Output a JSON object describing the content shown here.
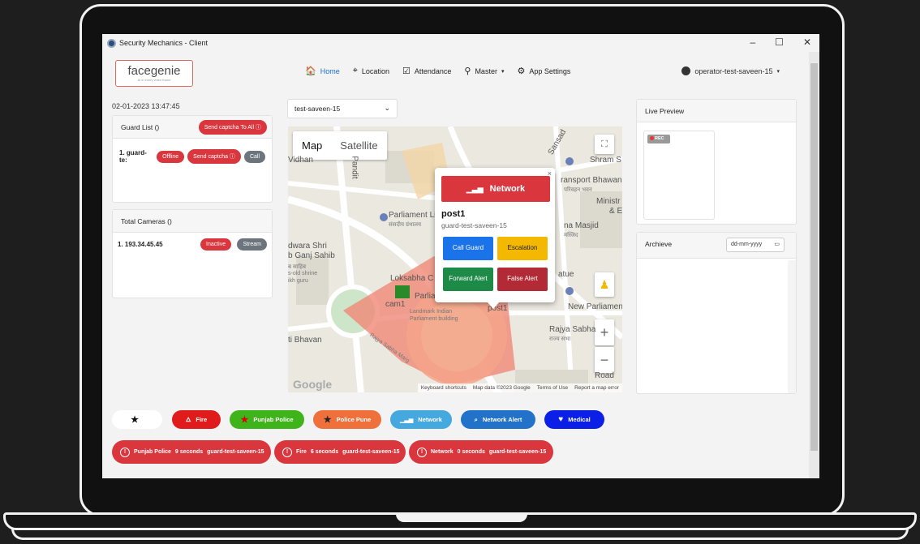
{
  "window": {
    "title": "Security Mechanics - Client",
    "min": "–",
    "max": "☐",
    "close": "✕"
  },
  "header": {
    "logo_text": "facegenie",
    "logo_tagline": "AI in every video frame",
    "nav": [
      {
        "label": "Home",
        "icon": "home-icon",
        "glyph": "🏠"
      },
      {
        "label": "Location",
        "icon": "location-pin-icon",
        "glyph": "⌖"
      },
      {
        "label": "Attendance",
        "icon": "calendar-check-icon",
        "glyph": "☑"
      },
      {
        "label": "Master",
        "icon": "user-icon",
        "glyph": "⚲",
        "caret": "▾"
      },
      {
        "label": "App Settings",
        "icon": "gear-icon",
        "glyph": "⚙"
      }
    ],
    "user": "operator-test-saveen-15",
    "user_caret": "▾"
  },
  "left": {
    "datetime": "02-01-2023 13:47:45",
    "guard_list": {
      "title": "Guard List ()",
      "send_all_label": "Send captcha To All",
      "rows": [
        {
          "name": "1. guard-te:",
          "status": "Offline",
          "captcha": "Send captcha",
          "call": "Call"
        }
      ]
    },
    "cameras": {
      "title": "Total Cameras ()",
      "rows": [
        {
          "name": "1. 193.34.45.45",
          "status": "Inactive",
          "stream": "Stream"
        }
      ]
    }
  },
  "map": {
    "location_select": "test-saveen-15",
    "tabs": [
      "Map",
      "Satellite"
    ],
    "labels": {
      "parliament_library": "Parliament Library",
      "parliament_library_hi": "संसदीय ग्रंथालय",
      "transport_bhawan": "ransport Bhawan",
      "transport_bhawan_hi": "परिवहन भवन",
      "ministry": "Ministr",
      "ministry2": "& E",
      "masjid": "na Masjid",
      "masjid_hi": "मस्जिद",
      "gurudwara1": "dwara Shri",
      "gurudwara2": "b Ganj Sahib",
      "gurudwara3": "ब साहिब",
      "gurudwara4": "s-old shrine",
      "gurudwara5": "ikh guru",
      "loksabha": "Loksabha C",
      "parliament_of": "Parliament of",
      "landmark1": "Landmark Indian",
      "landmark2": "Parliament building",
      "new_parliament": "New Parliamen",
      "rajya_sabha": "Rajya Sabha",
      "rajya_sabha_hi": "राज्य सभा",
      "rajya_marg": "Rajya Sabha Marg",
      "bhavan": "ti Bhavan",
      "sansad": "Sansad",
      "shram": "Shram S",
      "atue": "atue",
      "road": "Road",
      "vidhan": "Vidhan",
      "pandit": "Pandit",
      "cam": "cam1",
      "post": "post1"
    },
    "attribution": [
      "Keyboard shortcuts",
      "Map data ©2023 Google",
      "Terms of Use",
      "Report a map error"
    ],
    "google": "Google",
    "zoom_in": "+",
    "zoom_out": "−"
  },
  "popup": {
    "banner": "Network",
    "title": "post1",
    "subtitle": "guard-test-saveen-15",
    "close": "×",
    "buttons": {
      "call": "Call Guard",
      "escalation": "Escalation",
      "forward": "Forward Alert",
      "false": "False Alert"
    }
  },
  "right": {
    "live_preview_title": "Live Preview",
    "rec": "REC",
    "archive_title": "Archieve",
    "date_placeholder": "dd-mm-yyyy"
  },
  "legend": [
    {
      "label": "",
      "color": "#ffffff",
      "icon": "star-icon"
    },
    {
      "label": "Fire",
      "color": "#e01b1b",
      "icon": "fire-icon"
    },
    {
      "label": "Punjab Police",
      "color": "#3fb41a",
      "icon": "star-icon"
    },
    {
      "label": "Police Pune",
      "color": "#f0703c",
      "icon": "star-icon"
    },
    {
      "label": "Network",
      "color": "#45a8df",
      "icon": "signal-icon"
    },
    {
      "label": "Network Alert",
      "color": "#2372c9",
      "icon": "search-icon"
    },
    {
      "label": "Medical",
      "color": "#0b1fe6",
      "icon": "heart-icon"
    }
  ],
  "alerts": [
    {
      "type": "Punjab Police",
      "time": "9 seconds",
      "guard": "guard-test-saveen-15"
    },
    {
      "type": "Fire",
      "time": "6 seconds",
      "guard": "guard-test-saveen-15"
    },
    {
      "type": "Network",
      "time": "0 seconds",
      "guard": "guard-test-saveen-15"
    }
  ],
  "colors": {
    "primary_red": "#d9363e",
    "blue": "#1a6fd6",
    "yellow": "#f5b800",
    "green": "#1e8a48",
    "dark_red": "#b22a35"
  }
}
